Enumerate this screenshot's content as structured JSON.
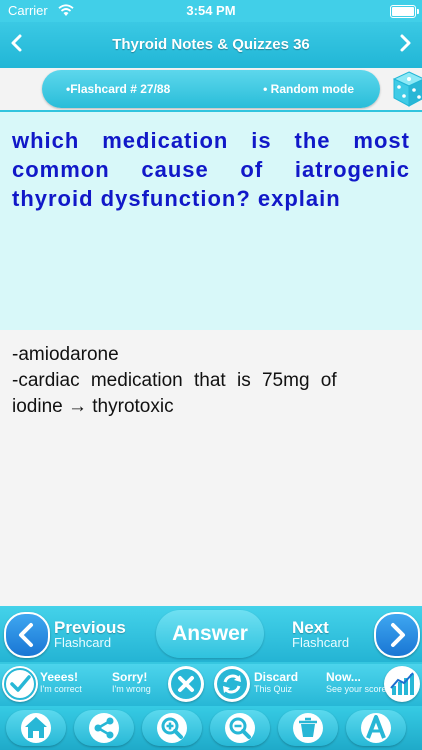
{
  "status": {
    "carrier": "Carrier",
    "time": "3:54 PM"
  },
  "nav": {
    "title": "Thyroid Notes & Quizzes 36",
    "back_icon": "chevron-left-icon",
    "forward_icon": "chevron-right-icon"
  },
  "info": {
    "flashcard": "•Flashcard #  27/88",
    "mode": "• Random mode",
    "dice_icon": "dice-icon"
  },
  "question": {
    "text": "which medication is the most common cause of iatrogenic thyroid dysfunction? explain"
  },
  "answer": {
    "lines": [
      "-amiodarone",
      "-cardiac medication that is 75mg of",
      "iodine → thyrotoxic"
    ]
  },
  "toolbar": {
    "previous": {
      "title": "Previous",
      "sub": "Flashcard"
    },
    "answer": "Answer",
    "next": {
      "title": "Next",
      "sub": "Flashcard"
    },
    "yes": {
      "title": "Yeees!",
      "sub": "I'm correct"
    },
    "sorry": {
      "title": "Sorry!",
      "sub": "I'm wrong"
    },
    "discard": {
      "title": "Discard",
      "sub": "This Quiz"
    },
    "now": {
      "title": "Now...",
      "sub": "See your score"
    },
    "icons": [
      "home-icon",
      "share-icon",
      "zoom-in-icon",
      "zoom-out-icon",
      "clear-icon",
      "font-size-icon"
    ]
  },
  "colors": {
    "accent": "#36c7e0",
    "question_bg": "#d8f8f9",
    "question_text": "#1118c8"
  }
}
